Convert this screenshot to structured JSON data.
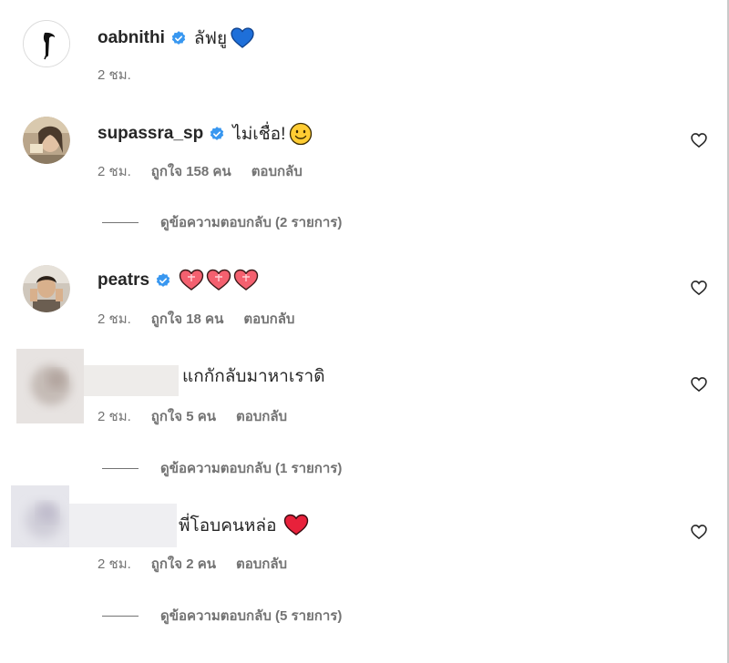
{
  "comments": [
    {
      "username": "oabnithi",
      "text": "ลัฟยู",
      "time": "2 ชม.",
      "likes": "",
      "reply": ""
    },
    {
      "username": "supassra_sp",
      "text": "ไม่เชื่อ!",
      "time": "2 ชม.",
      "likes": "ถูกใจ 158 คน",
      "reply": "ตอบกลับ",
      "view_replies": "ดูข้อความตอบกลับ (2 รายการ)"
    },
    {
      "username": "peatrs",
      "text": "",
      "time": "2 ชม.",
      "likes": "ถูกใจ 18 คน",
      "reply": "ตอบกลับ"
    },
    {
      "username": "",
      "text": "แกกักลับมาหาเราดิ",
      "time": "2 ชม.",
      "likes": "ถูกใจ 5 คน",
      "reply": "ตอบกลับ",
      "view_replies": "ดูข้อความตอบกลับ (1 รายการ)"
    },
    {
      "username": "",
      "text": "พี่โอบคนหล่อ",
      "time": "2 ชม.",
      "likes": "ถูกใจ 2 คน",
      "reply": "ตอบกลับ",
      "view_replies": "ดูข้อความตอบกลับ (5 รายการ)"
    }
  ],
  "icons": {
    "verified": "verified-badge-icon",
    "like": "heart-outline-icon",
    "blue_heart": "blue-heart-emoji",
    "red_heart": "red-heart-emoji",
    "sparkle_heart": "sparkling-heart-emoji",
    "smiley": "slightly-smiling-face-emoji"
  },
  "colors": {
    "verified_blue": "#3897f0",
    "meta_gray": "#737373",
    "text_dark": "#262626"
  }
}
